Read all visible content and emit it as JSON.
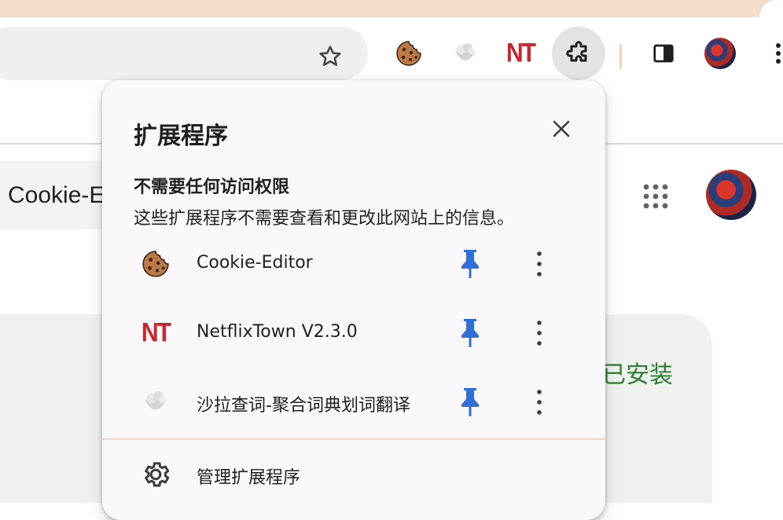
{
  "page": {
    "search_text": "Cookie-E",
    "installed_label": "已安装"
  },
  "extensions_popup": {
    "title": "扩展程序",
    "section_heading": "不需要任何访问权限",
    "section_description": "这些扩展程序不需要查看和更改此网站上的信息。",
    "items": [
      {
        "name": "Cookie-Editor",
        "icon": "cookie-icon",
        "pinned": true
      },
      {
        "name": "NetflixTown V2.3.0",
        "icon": "nt-logo-icon",
        "icon_text": "NT",
        "pinned": true
      },
      {
        "name": "沙拉查词-聚合词典划词翻译",
        "icon": "saladict-icon",
        "pinned": true
      }
    ],
    "manage_label": "管理扩展程序"
  },
  "toolbar": {
    "nt_text": "NT"
  },
  "colors": {
    "accent_pin": "#2f6fd6",
    "nt_red": "#c9252c",
    "installed_green": "#2e7d32",
    "tab_strip": "#f6dccd"
  }
}
